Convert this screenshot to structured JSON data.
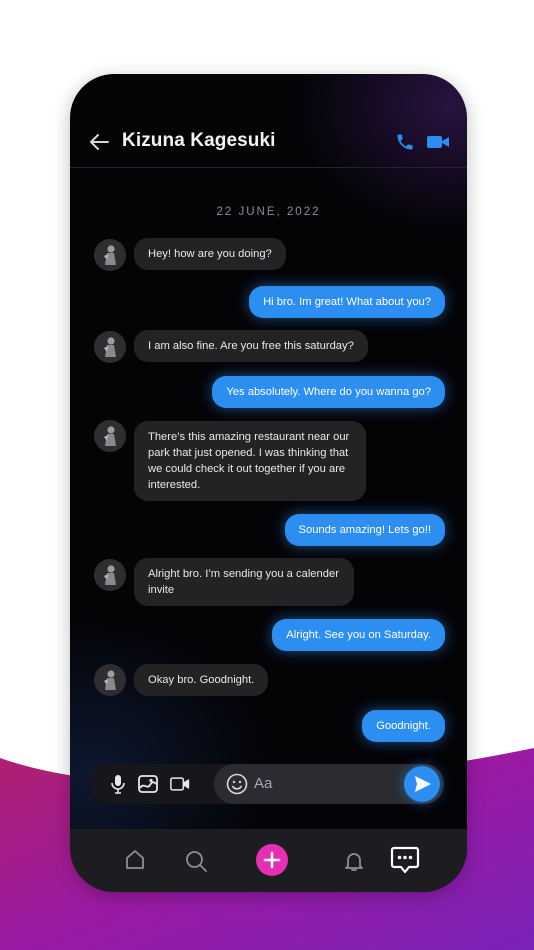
{
  "header": {
    "contact_name": "Kizuna Kagesuki",
    "back_icon": "arrow-left-icon",
    "call_icon": "phone-icon",
    "video_icon": "video-camera-icon"
  },
  "conversation": {
    "date": "22 JUNE, 2022",
    "messages": [
      {
        "from": "them",
        "text": "Hey! how are you doing?"
      },
      {
        "from": "me",
        "text": "Hi bro. Im great! What about you?"
      },
      {
        "from": "them",
        "text": "I am also fine. Are you free this saturday?"
      },
      {
        "from": "me",
        "text": "Yes absolutely. Where do you wanna go?"
      },
      {
        "from": "them",
        "text": "There’s this amazing restaurant near our park that just opened. I was thinking that we could check it out together if you are interested."
      },
      {
        "from": "me",
        "text": "Sounds amazing! Lets go!!"
      },
      {
        "from": "them",
        "text": "Alright bro. I’m sending you a calender invite"
      },
      {
        "from": "me",
        "text": "Alright. See you on Saturday."
      },
      {
        "from": "them",
        "text": "Okay bro. Goodnight."
      },
      {
        "from": "me",
        "text": "Goodnight."
      }
    ]
  },
  "composer": {
    "placeholder": "Aa",
    "icons": [
      "microphone-icon",
      "image-icon",
      "video-icon",
      "emoji-icon",
      "send-icon"
    ]
  },
  "bottom_nav": {
    "items": [
      "home-icon",
      "search-icon",
      "add-icon",
      "notifications-icon",
      "chat-icon"
    ],
    "active": "chat-icon"
  },
  "colors": {
    "accent": "#2b8ef0",
    "add_button": "#e62fb3",
    "incoming_bubble": "#232326",
    "background_wave": "#9b1fa8"
  }
}
